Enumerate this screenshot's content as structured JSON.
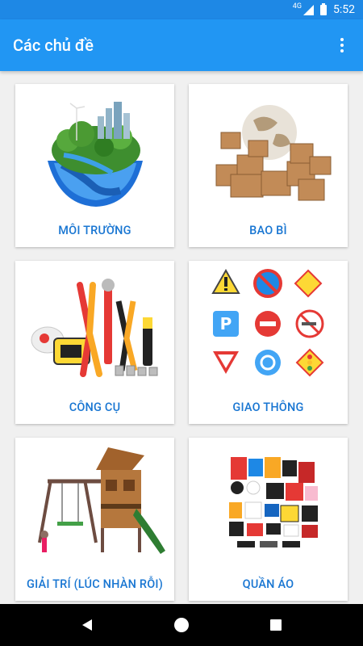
{
  "status": {
    "network": "4G",
    "time": "5:52"
  },
  "app_bar": {
    "title": "Các chủ đề",
    "menu_icon": "more-vert-icon"
  },
  "topics": [
    {
      "label": "MÔI TRƯỜNG",
      "icon": "earth-environment-image"
    },
    {
      "label": "BAO BÌ",
      "icon": "cardboard-boxes-image"
    },
    {
      "label": "CÔNG CỤ",
      "icon": "hand-tools-image"
    },
    {
      "label": "GIAO THÔNG",
      "icon": "traffic-signs-image"
    },
    {
      "label": "GIẢI TRÍ (LÚC NHÀN RỖI)",
      "icon": "playground-image"
    },
    {
      "label": "QUẦN ÁO",
      "icon": "clothes-image"
    }
  ],
  "colors": {
    "status_bar": "#1e88e5",
    "app_bar": "#2196f3",
    "label": "#1976d2"
  },
  "nav": {
    "back": "back-icon",
    "home": "home-icon",
    "recents": "recents-icon"
  }
}
